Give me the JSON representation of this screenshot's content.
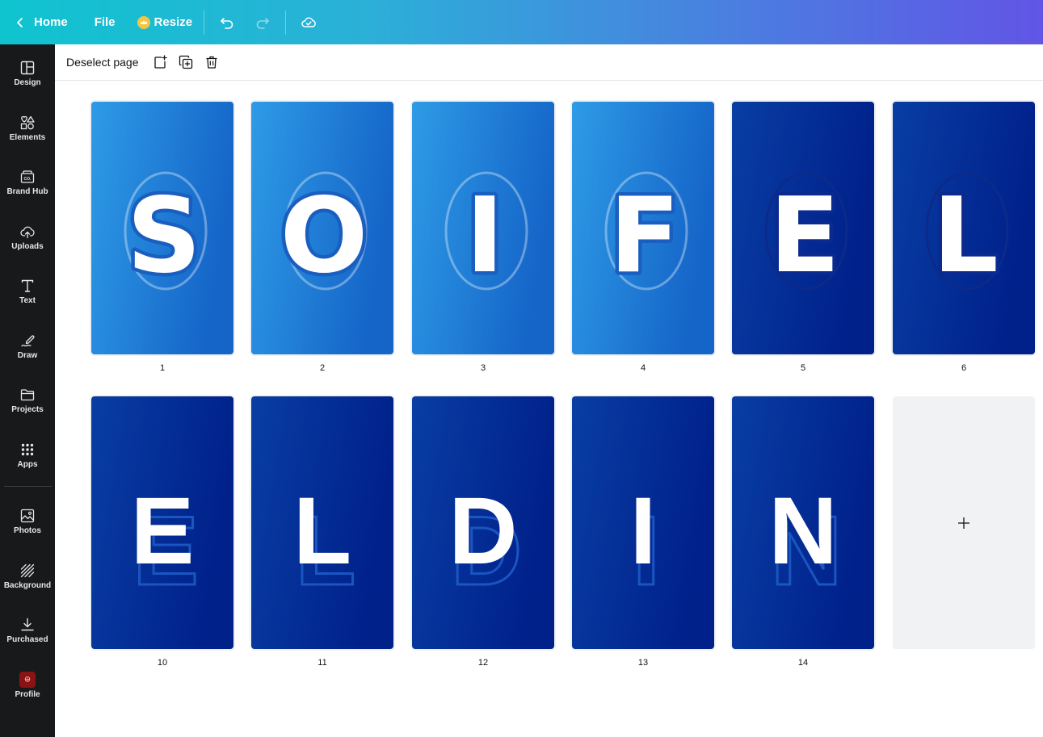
{
  "topbar": {
    "home_label": "Home",
    "file_label": "File",
    "resize_label": "Resize",
    "colors": {
      "gradient_start": "#0fc4cf",
      "gradient_end": "#6155e6"
    }
  },
  "sidebar": {
    "items": [
      {
        "label": "Design",
        "icon": "layout-icon"
      },
      {
        "label": "Elements",
        "icon": "shapes-icon"
      },
      {
        "label": "Brand Hub",
        "icon": "brand-hub-icon"
      },
      {
        "label": "Uploads",
        "icon": "cloud-upload-icon"
      },
      {
        "label": "Text",
        "icon": "text-icon"
      },
      {
        "label": "Draw",
        "icon": "draw-icon"
      },
      {
        "label": "Projects",
        "icon": "folder-icon"
      },
      {
        "label": "Apps",
        "icon": "apps-grid-icon"
      },
      {
        "label": "Photos",
        "icon": "image-icon"
      },
      {
        "label": "Background",
        "icon": "background-icon"
      },
      {
        "label": "Purchased",
        "icon": "download-icon"
      },
      {
        "label": "Profile",
        "icon": "avatar"
      }
    ]
  },
  "pagebar": {
    "deselect_label": "Deselect page"
  },
  "pages": [
    {
      "number": "1",
      "letter": "S",
      "style": "light"
    },
    {
      "number": "2",
      "letter": "O",
      "style": "light"
    },
    {
      "number": "3",
      "letter": "I",
      "style": "light"
    },
    {
      "number": "4",
      "letter": "F",
      "style": "light"
    },
    {
      "number": "5",
      "letter": "E",
      "style": "dark"
    },
    {
      "number": "6",
      "letter": "L",
      "style": "dark"
    },
    {
      "number": "10",
      "letter": "E",
      "style": "block"
    },
    {
      "number": "11",
      "letter": "L",
      "style": "block"
    },
    {
      "number": "12",
      "letter": "D",
      "style": "block"
    },
    {
      "number": "13",
      "letter": "I",
      "style": "block"
    },
    {
      "number": "14",
      "letter": "N",
      "style": "block"
    }
  ],
  "add_page": {
    "icon": "plus-icon"
  },
  "colors": {
    "light_bg_start": "#2e9be6",
    "light_bg_end": "#1565c8",
    "dark_bg_start": "#083ea3",
    "dark_bg_end": "#00208a",
    "letter_fill": "#ffffff"
  }
}
